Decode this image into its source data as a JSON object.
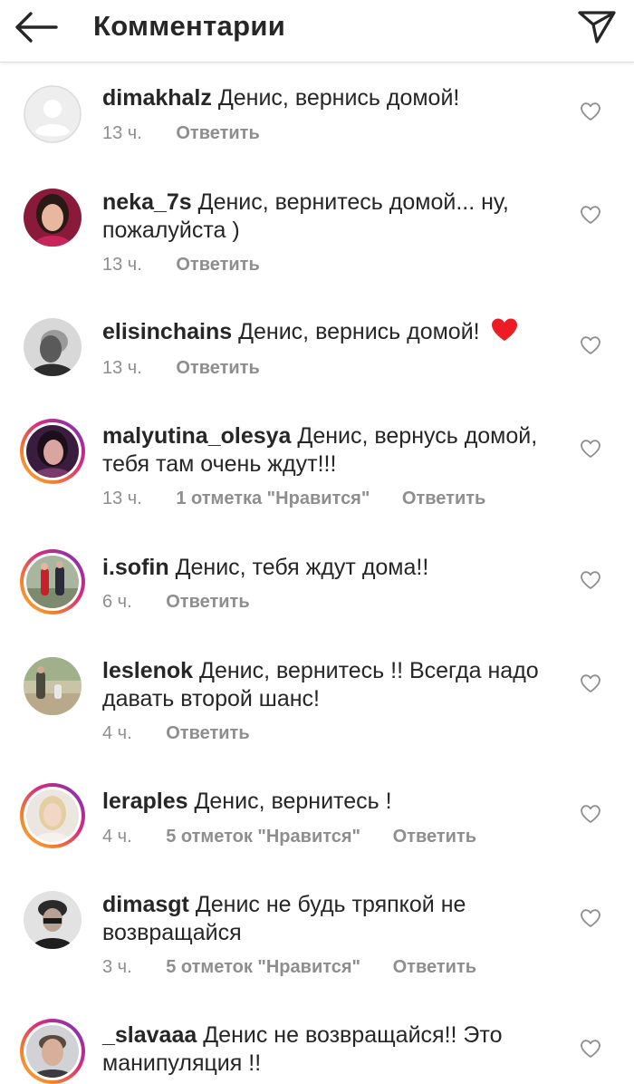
{
  "header": {
    "title": "Комментарии",
    "back_icon": "arrow-left-icon",
    "send_icon": "paper-plane-icon"
  },
  "comments": [
    {
      "username": "dimakhalz",
      "text": "Денис, вернись домой!",
      "time": "13 ч.",
      "likes": "",
      "reply": "Ответить",
      "avatar": "default-avatar"
    },
    {
      "username": "neka_7s",
      "text": "Денис, вернитесь домой... ну, пожалуйста )",
      "time": "13 ч.",
      "likes": "",
      "reply": "Ответить",
      "avatar": "photo-avatar"
    },
    {
      "username": "elisinchains",
      "text": "Денис, вернись домой!",
      "time": "13 ч.",
      "likes": "",
      "reply": "Ответить",
      "avatar": "photo-avatar",
      "emoji": "red-heart-emoji"
    },
    {
      "username": "malyutina_olesya",
      "text": "Денис, вернусь домой, тебя там очень ждут!!!",
      "time": "13 ч.",
      "likes": "1 отметка \"Нравится\"",
      "reply": "Ответить",
      "avatar": "story-ring-avatar"
    },
    {
      "username": "i.sofin",
      "text": "Денис, тебя ждут дома!!",
      "time": "6 ч.",
      "likes": "",
      "reply": "Ответить",
      "avatar": "story-ring-avatar"
    },
    {
      "username": "leslenok",
      "text": "Денис, вернитесь !! Всегда надо давать второй шанс!",
      "time": "4 ч.",
      "likes": "",
      "reply": "Ответить",
      "avatar": "photo-avatar"
    },
    {
      "username": "leraples",
      "text": "Денис, вернитесь !",
      "time": "4 ч.",
      "likes": "5 отметок \"Нравится\"",
      "reply": "Ответить",
      "avatar": "story-ring-avatar"
    },
    {
      "username": "dimasgt",
      "text": "Денис не будь тряпкой не возвращайся",
      "time": "3 ч.",
      "likes": "5 отметок \"Нравится\"",
      "reply": "Ответить",
      "avatar": "photo-avatar"
    },
    {
      "username": "_slavaaa",
      "text": "Денис не возвращайся!! Это манипуляция !!",
      "time": "",
      "likes": "",
      "reply": "",
      "avatar": "story-ring-avatar"
    }
  ],
  "colors": {
    "text": "#262626",
    "meta": "#8e8e8e",
    "heart_emoji": "#ed1c24"
  }
}
